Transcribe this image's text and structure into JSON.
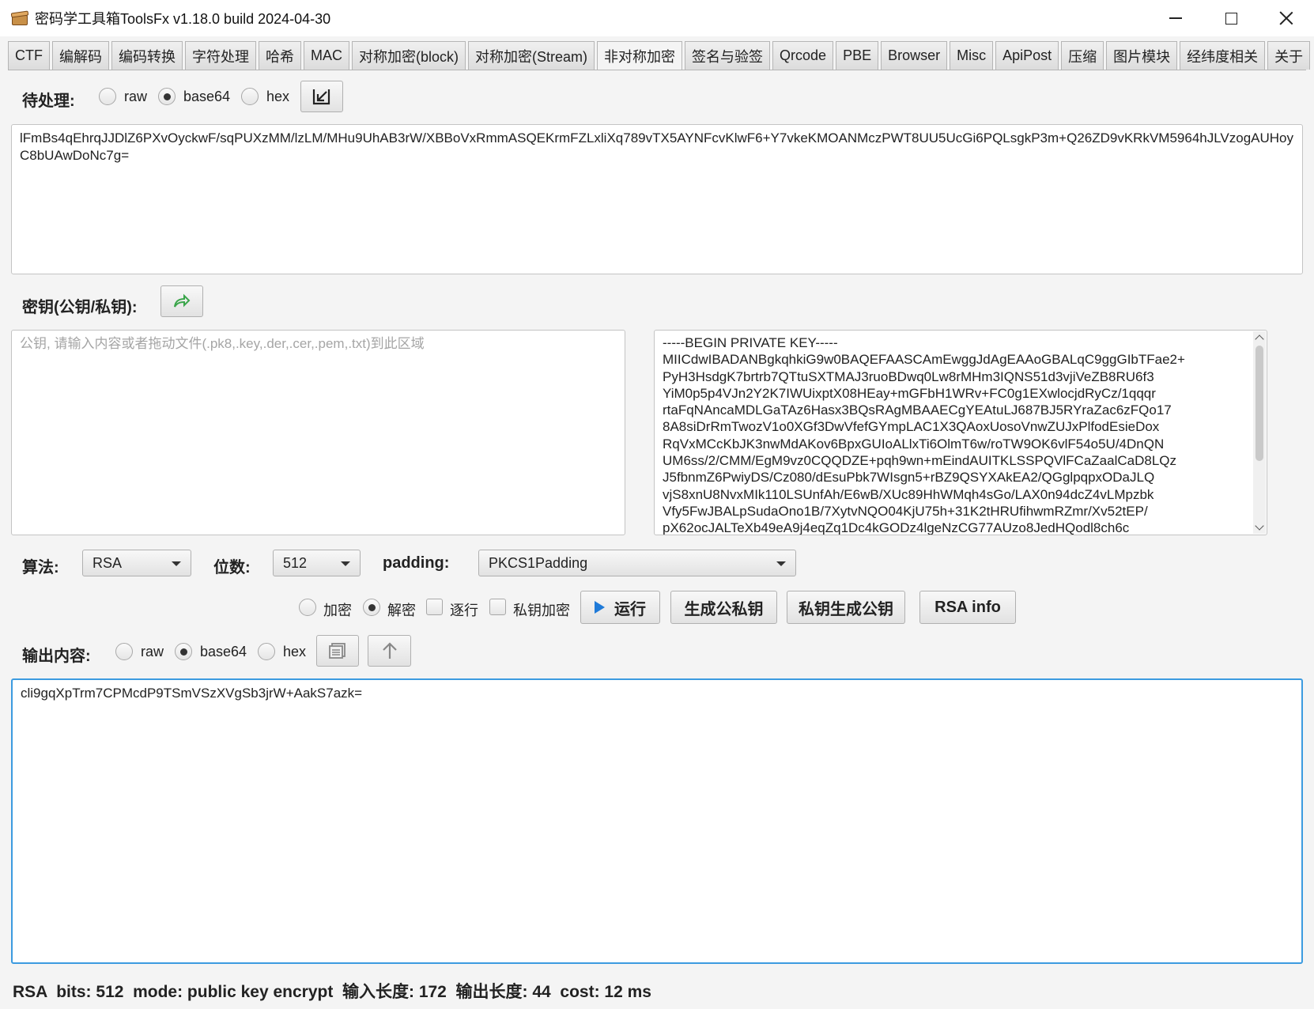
{
  "window": {
    "title": "密码学工具箱ToolsFx v1.18.0 build 2024-04-30",
    "app_icon": "treasure-chest-icon"
  },
  "tabs": [
    {
      "label": "CTF"
    },
    {
      "label": "编解码"
    },
    {
      "label": "编码转换"
    },
    {
      "label": "字符处理"
    },
    {
      "label": "哈希"
    },
    {
      "label": "MAC"
    },
    {
      "label": "对称加密(block)"
    },
    {
      "label": "对称加密(Stream)"
    },
    {
      "label": "非对称加密"
    },
    {
      "label": "签名与验签"
    },
    {
      "label": "Qrcode"
    },
    {
      "label": "PBE"
    },
    {
      "label": "Browser"
    },
    {
      "label": "Misc"
    },
    {
      "label": "ApiPost"
    },
    {
      "label": "压缩"
    },
    {
      "label": "图片模块"
    },
    {
      "label": "经纬度相关"
    },
    {
      "label": "关于"
    }
  ],
  "active_tab": "非对称加密",
  "input": {
    "label": "待处理:",
    "formats": [
      "raw",
      "base64",
      "hex"
    ],
    "selected_format": "base64",
    "import_icon": "import-arrow-icon",
    "value": "lFmBs4qEhrqJJDlZ6PXvOyckwF/sqPUXzMM/lzLM/MHu9UhAB3rW/XBBoVxRmmASQEKrmFZLxliXq789vTX5AYNFcvKlwF6+Y7vkeKMOANMczPWT8UU5UcGi6PQLsgkP3m+Q26ZD9vKRkVM5964hJLVzogAUHoyC8bUAwDoNc7g="
  },
  "key": {
    "label": "密钥(公钥/私钥):",
    "swap_icon": "share-arrow-icon",
    "public_placeholder": "公钥, 请输入内容或者拖动文件(.pk8,.key,.der,.cer,.pem,.txt)到此区域",
    "private_lines": [
      "-----BEGIN PRIVATE KEY-----",
      "MIICdwIBADANBgkqhkiG9w0BAQEFAASCAmEwggJdAgEAAoGBALqC9ggGIbTFae2+",
      "PyH3HsdgK7brtrb7QTtuSXTMAJ3ruoBDwq0Lw8rMHm3IQNS51d3vjiVeZB8RU6f3",
      "YiM0p5p4VJn2Y2K7IWUixptX08HEay+mGFbH1WRv+FC0g1EXwlocjdRyCz/1qqqr",
      "rtaFqNAncaMDLGaTAz6Hasx3BQsRAgMBAAECgYEAtuLJ687BJ5RYraZac6zFQo17",
      "8A8siDrRmTwozV1o0XGf3DwVfefGYmpLAC1X3QAoxUosoVnwZUJxPlfodEsieDox",
      "RqVxMCcKbJK3nwMdAKov6BpxGUIoALlxTi6OlmT6w/roTW9OK6vlF54o5U/4DnQN",
      "UM6ss/2/CMM/EgM9vz0CQQDZE+pqh9wn+mEindAUITKLSSPQVlFCaZaalCaD8LQz",
      "J5fbnmZ6PwiyDS/Cz080/dEsuPbk7WIsgn5+rBZ9QSYXAkEA2/QGglpqpxODaJLQ",
      "vjS8xnU8NvxMIk110LSUnfAh/E6wB/XUc89HhWMqh4sGo/LAX0n94dcZ4vLMpzbk",
      "Vfy5FwJBALpSudaOno1B/7XytvNQO04KjU75h+31K2tHRUfihwmRZmr/Xv52tEP/",
      "pX62ocJALTeXb49eA9j4eqZq1Dc4kGODz4lgeNzCG77AUzo8JedHQodl8ch6c"
    ]
  },
  "algo": {
    "algo_label": "算法:",
    "algo_value": "RSA",
    "bits_label": "位数:",
    "bits_value": "512",
    "padding_label": "padding:",
    "padding_value": "PKCS1Padding"
  },
  "options": {
    "encrypt_label": "加密",
    "decrypt_label": "解密",
    "selected_mode": "解密",
    "line_by_line_label": "逐行",
    "private_encrypt_label": "私钥加密",
    "run_label": "运行",
    "gen_keypair_label": "生成公私钥",
    "priv_to_pub_label": "私钥生成公钥",
    "rsa_info_label": "RSA info"
  },
  "output": {
    "label": "输出内容:",
    "formats": [
      "raw",
      "base64",
      "hex"
    ],
    "selected_format": "base64",
    "copy_icon": "copy-icon",
    "up_icon": "arrow-up-icon",
    "value": "cli9gqXpTrm7CPMcdP9TSmVSzXVgSb3jrW+AakS7azk="
  },
  "status": {
    "text": "RSA  bits: 512  mode: public key encrypt  输入长度: 172  输出长度: 44  cost: 12 ms"
  }
}
